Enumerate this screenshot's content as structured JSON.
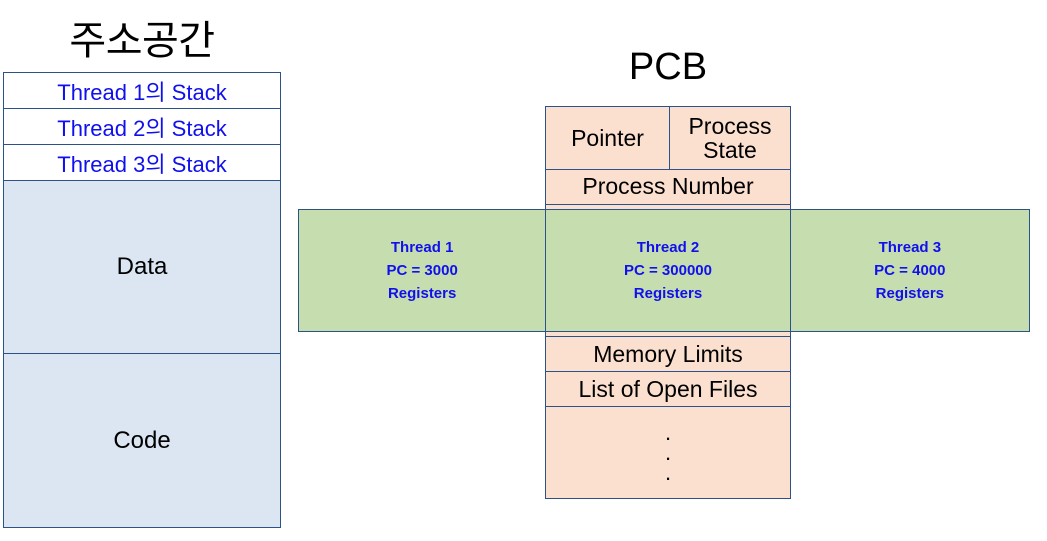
{
  "diagram": {
    "type": "diagram",
    "background_color": "#ffffff",
    "border_color": "#2b5289",
    "accent_blue_text": "#1010ef",
    "fill_light_blue": "#dce6f2",
    "fill_peach": "#fbe0d0",
    "fill_green": "#c6ddaf"
  },
  "address_space": {
    "title": "주소공간",
    "rows": [
      {
        "label": "Thread 1의 Stack",
        "kind": "stack"
      },
      {
        "label": "Thread 2의 Stack",
        "kind": "stack"
      },
      {
        "label": "Thread 3의 Stack",
        "kind": "stack"
      },
      {
        "label": "Data",
        "kind": "segment"
      },
      {
        "label": "Code",
        "kind": "segment"
      }
    ]
  },
  "pcb": {
    "title": "PCB",
    "pointer_label": "Pointer",
    "process_state_line1": "Process",
    "process_state_line2": "State",
    "process_number_label": "Process Number",
    "memory_limits_label": "Memory Limits",
    "open_files_label": "List of Open Files",
    "ellipsis": [
      ".",
      ".",
      "."
    ]
  },
  "thread_band": {
    "threads": [
      {
        "name": "Thread 1",
        "pc": "PC = 3000",
        "registers": "Registers"
      },
      {
        "name": "Thread 2",
        "pc": "PC = 300000",
        "registers": "Registers"
      },
      {
        "name": "Thread 3",
        "pc": "PC = 4000",
        "registers": "Registers"
      }
    ]
  }
}
